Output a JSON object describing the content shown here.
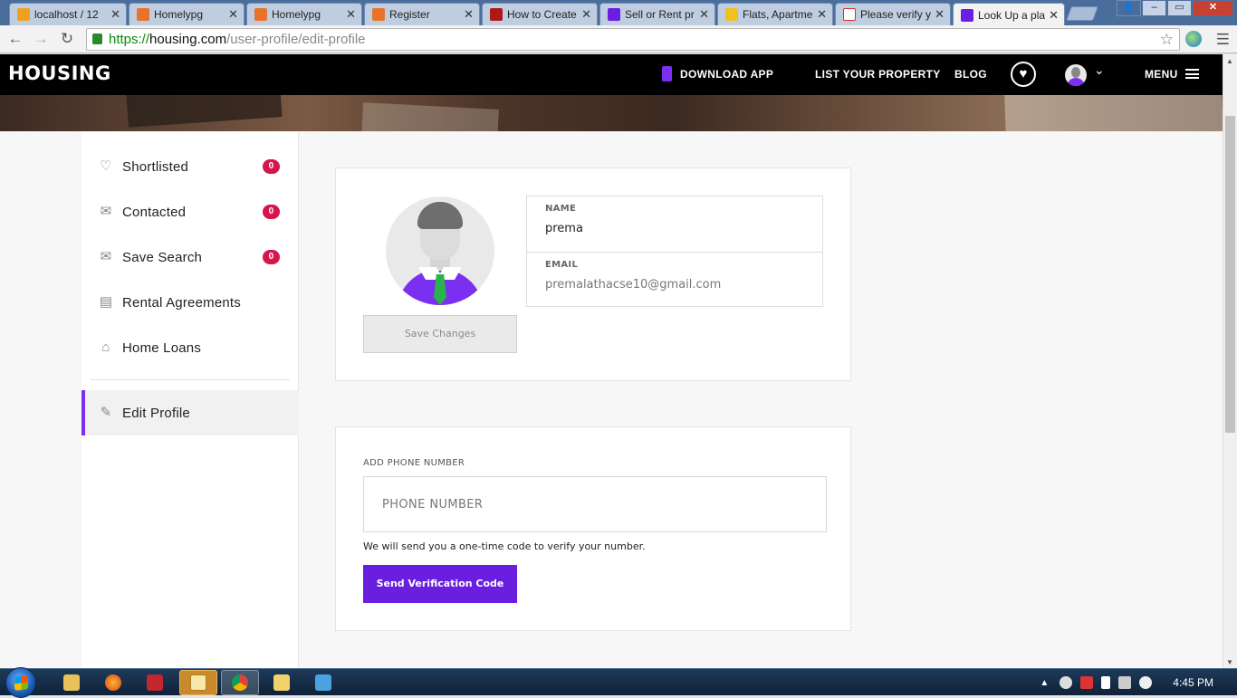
{
  "browser": {
    "tabs": [
      {
        "title": "localhost / 12",
        "favicon_color": "#f0a020",
        "active": false
      },
      {
        "title": "Homelypg",
        "favicon_color": "#e8742c",
        "active": false
      },
      {
        "title": "Homelypg",
        "favicon_color": "#e8742c",
        "active": false
      },
      {
        "title": "Register",
        "favicon_color": "#e8742c",
        "active": false
      },
      {
        "title": "How to Create",
        "favicon_color": "#b01818",
        "active": false
      },
      {
        "title": "Sell or Rent pr",
        "favicon_color": "#6a1ee0",
        "active": false
      },
      {
        "title": "Flats, Apartme",
        "favicon_color": "#f3c01c",
        "active": false
      },
      {
        "title": "Please verify y",
        "favicon_color": "#d93025",
        "active": false
      },
      {
        "title": "Look Up a pla",
        "favicon_color": "#6a1ee0",
        "active": true
      }
    ],
    "url_scheme": "https://",
    "url_host": "housing.com",
    "url_path": "/user-profile/edit-profile"
  },
  "header": {
    "logo": "HOUSING",
    "download_app": "DOWNLOAD APP",
    "list_property": "LIST YOUR PROPERTY",
    "blog": "BLOG",
    "menu": "MENU",
    "accent_color": "#7b2ff0"
  },
  "sidebar": {
    "items": [
      {
        "label": "Shortlisted",
        "icon": "heart-outline-icon",
        "badge": "0"
      },
      {
        "label": "Contacted",
        "icon": "envelope-icon",
        "badge": "0"
      },
      {
        "label": "Save Search",
        "icon": "mail-search-icon",
        "badge": "0"
      },
      {
        "label": "Rental Agreements",
        "icon": "document-icon",
        "badge": null
      },
      {
        "label": "Home Loans",
        "icon": "home-icon",
        "badge": null
      }
    ],
    "active_item": {
      "label": "Edit Profile",
      "icon": "pencil-icon"
    },
    "badge_color": "#d6154d"
  },
  "profile": {
    "save_label": "Save Changes",
    "name_label": "NAME",
    "name_value": "prema",
    "email_label": "EMAIL",
    "email_value": "premalathacse10@gmail.com"
  },
  "phone": {
    "section_label": "ADD PHONE NUMBER",
    "placeholder": "PHONE NUMBER",
    "hint": "We will send you a one-time code to verify your number.",
    "button_label": "Send Verification Code",
    "button_color": "#6a1ee0"
  },
  "taskbar": {
    "clock": "4:45 PM"
  }
}
